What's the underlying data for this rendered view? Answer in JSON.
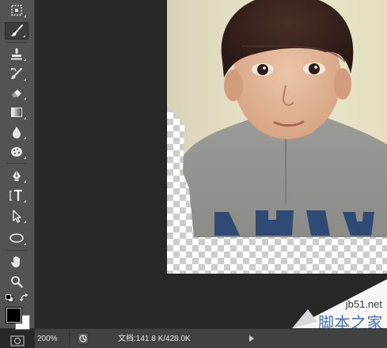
{
  "status_bar": {
    "zoom": "200%",
    "doc_label": "文档:",
    "doc_size": "141.8 K/428.0K"
  },
  "watermark": {
    "url": "jb51.net",
    "name": "脚本之家"
  },
  "colors": {
    "foreground": "#000000",
    "background": "#ffffff",
    "toolbar": "#535353",
    "workspace": "#282828",
    "watermark_blue": "#4a6fb5"
  },
  "tools": [
    "marquee-icon",
    "brush-icon",
    "stamp-icon",
    "history-brush-icon",
    "eraser-icon",
    "gradient-icon",
    "blur-drop-icon",
    "sponge-icon",
    "pen-icon",
    "type-icon",
    "path-select-icon",
    "ellipse-icon",
    "hand-icon",
    "zoom-icon"
  ]
}
